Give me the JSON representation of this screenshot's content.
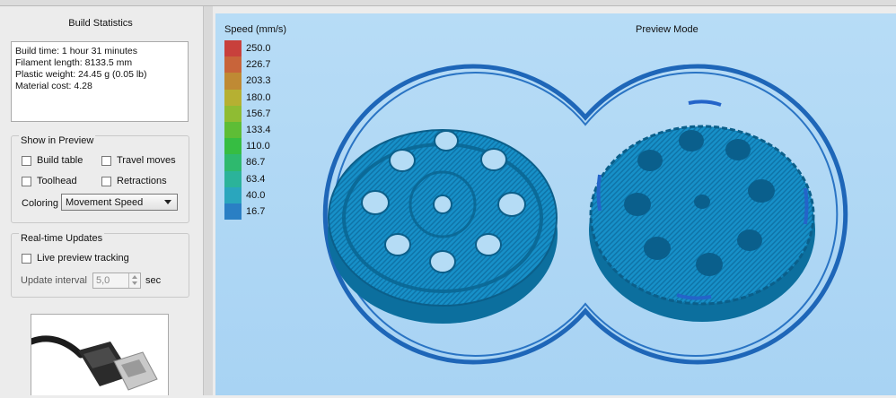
{
  "build_statistics": {
    "title": "Build Statistics",
    "lines": [
      "Build time: 1 hour 31 minutes",
      "Filament length: 8133.5 mm",
      "Plastic weight: 24.45 g (0.05 lb)",
      "Material cost: 4.28"
    ]
  },
  "show_in_preview": {
    "title": "Show in Preview",
    "build_table": "Build table",
    "travel_moves": "Travel moves",
    "toolhead": "Toolhead",
    "retractions": "Retractions",
    "coloring_label": "Coloring",
    "coloring_value": "Movement Speed"
  },
  "realtime_updates": {
    "title": "Real-time Updates",
    "live_preview": "Live preview tracking",
    "update_interval_label": "Update interval",
    "update_interval_value": "5,0",
    "update_interval_unit": "sec"
  },
  "preview": {
    "mode_label": "Preview Mode",
    "legend_title": "Speed (mm/s)",
    "legend": [
      {
        "value": "250.0",
        "color": "#c8403c"
      },
      {
        "value": "226.7",
        "color": "#c8643a"
      },
      {
        "value": "203.3",
        "color": "#bf8a34"
      },
      {
        "value": "180.0",
        "color": "#b6b032"
      },
      {
        "value": "156.7",
        "color": "#8fbc33"
      },
      {
        "value": "133.4",
        "color": "#5ebd36"
      },
      {
        "value": "110.0",
        "color": "#36bd42"
      },
      {
        "value": "86.7",
        "color": "#2eb96e"
      },
      {
        "value": "63.4",
        "color": "#2bb39a"
      },
      {
        "value": "40.0",
        "color": "#2aa6bd"
      },
      {
        "value": "16.7",
        "color": "#2a7fc4"
      }
    ]
  }
}
